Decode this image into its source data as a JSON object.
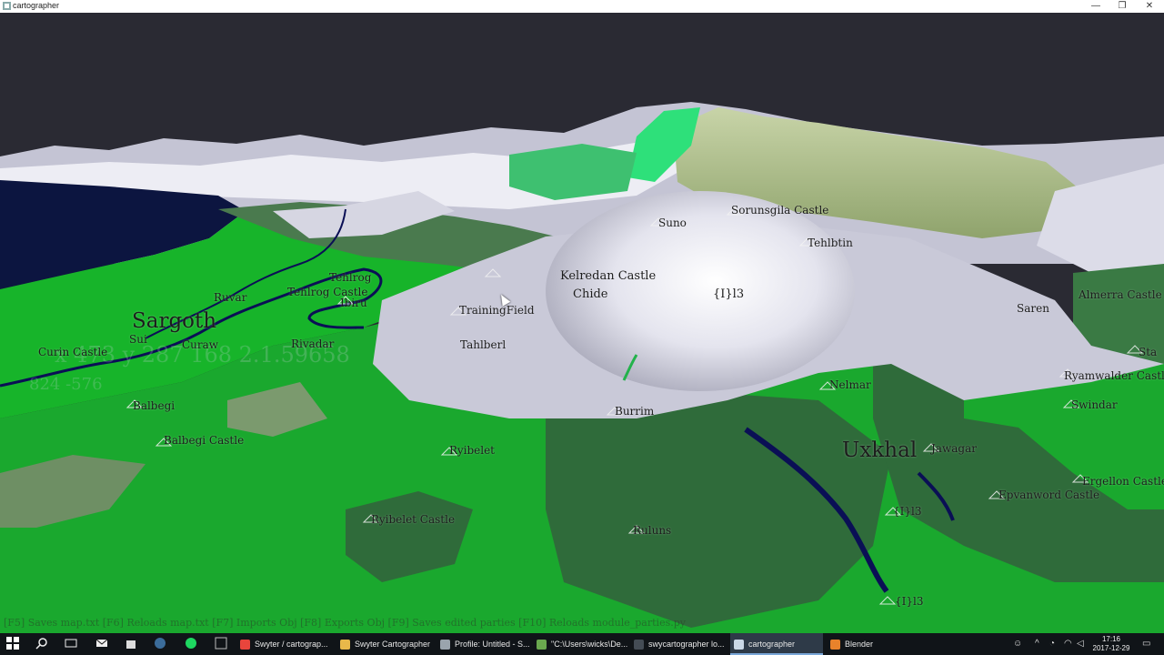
{
  "window": {
    "title": "cartographer",
    "controls": [
      "—",
      "❐",
      "✕"
    ]
  },
  "map": {
    "region_labels": [
      {
        "text": "Sargoth"
      },
      {
        "text": "Uxkhal"
      }
    ],
    "place_labels": [
      {
        "text": "Kelredan Castle"
      },
      {
        "text": "Chide"
      },
      {
        "text": "{I}l3"
      },
      {
        "text": "Suno"
      },
      {
        "text": "Sorunsgila Castle"
      },
      {
        "text": "Tehlbtin"
      },
      {
        "text": "TrainingField"
      },
      {
        "text": "Tahlberl"
      },
      {
        "text": "Tehlrog Castle"
      },
      {
        "text": "Ruvar"
      },
      {
        "text": "Rivadar"
      },
      {
        "text": "Balbegi"
      },
      {
        "text": "Balbegi Castle"
      },
      {
        "text": "Ryibelet"
      },
      {
        "text": "Ryibelet Castle"
      },
      {
        "text": "Burrim"
      },
      {
        "text": "Nelmar"
      },
      {
        "text": "Ruluns"
      },
      {
        "text": "Almerra Castle"
      },
      {
        "text": "Saren"
      },
      {
        "text": "Ryamwalder Castle"
      },
      {
        "text": "Swindar"
      },
      {
        "text": "Jawagar"
      },
      {
        "text": "Epvanword Castle"
      },
      {
        "text": "Ergellon Castle"
      },
      {
        "text": "{I}l3"
      },
      {
        "text": "{I}l3"
      },
      {
        "text": "Curin Castle"
      },
      {
        "text": "Sui"
      },
      {
        "text": "Curaw"
      },
      {
        "text": "Ibiru"
      },
      {
        "text": "Sta"
      },
      {
        "text": "Tehlrog"
      }
    ],
    "coordinate_readout": "x 473 y 287 168 2.1.59658",
    "coordinate_readout_2": "824   -576",
    "help_text": "[F5] Saves map.txt [F6] Reloads map.txt [F7] Imports Obj [F8] Exports Obj [F9] Saves edited parties [F10] Reloads module_parties.py"
  },
  "taskbar": {
    "apps": [
      {
        "label": "Swyter / cartograp...",
        "icon": "chrome-icon",
        "color": "#e8453c"
      },
      {
        "label": "Swyter Cartographer",
        "icon": "folder-icon",
        "color": "#e8b84a"
      },
      {
        "label": "Profile: Untitled - S...",
        "icon": "profiler-icon",
        "color": "#9aa4ad"
      },
      {
        "label": "\"C:\\Users\\wicks\\De...",
        "icon": "notepad-icon",
        "color": "#6aa84f"
      },
      {
        "label": "swycartographer lo...",
        "icon": "console-icon",
        "color": "#444c55"
      },
      {
        "label": "cartographer",
        "icon": "app-icon",
        "color": "#c9d7e6"
      },
      {
        "label": "Blender",
        "icon": "blender-icon",
        "color": "#e8822b"
      }
    ],
    "clock": {
      "time": "17:16",
      "date": "2017-12-29"
    }
  },
  "colors": {
    "sky": "#2a2a33",
    "bright_green": "#17b42a",
    "dark_green": "#2e6d3a",
    "snow": "#e6e6ef",
    "olive": "#a8b98a",
    "water": "#0c1540",
    "river": "#0a0f55"
  }
}
